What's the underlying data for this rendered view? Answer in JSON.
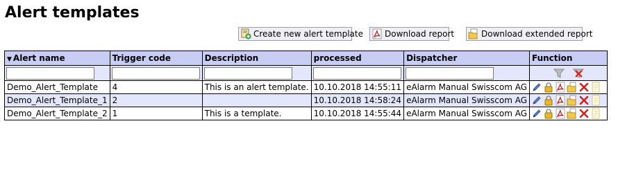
{
  "page": {
    "title": "Alert templates"
  },
  "toolbar": {
    "create_label": "Create new alert template",
    "download_label": "Download report",
    "download_ext_label": "Download extended report"
  },
  "table": {
    "sort_indicator": "▼",
    "headers": [
      "Alert name",
      "Trigger code",
      "Description",
      "processed",
      "Dispatcher",
      "Function"
    ],
    "filters": {
      "alert_name": "",
      "trigger_code": "",
      "description": "",
      "processed": "",
      "dispatcher": ""
    },
    "rows": [
      {
        "name": "Demo_Alert_Template",
        "trigger": "4",
        "description": "This is an alert template.",
        "processed": "10.10.2018 14:55:11",
        "dispatcher": "eAlarm Manual Swisscom AG"
      },
      {
        "name": "Demo_Alert_Template_1",
        "trigger": "2",
        "description": "",
        "processed": "10.10.2018 14:58:24",
        "dispatcher": "eAlarm Manual Swisscom AG"
      },
      {
        "name": "Demo_Alert_Template_2",
        "trigger": "1",
        "description": "This is a template.",
        "processed": "10.10.2018 14:55:44",
        "dispatcher": "eAlarm Manual Swisscom AG"
      }
    ],
    "row_actions": [
      "edit-icon",
      "lock-icon",
      "pdf-icon",
      "folder-icon",
      "delete-icon",
      "copy-icon"
    ],
    "filter_actions": [
      "filter-icon",
      "clear-filter-icon"
    ]
  },
  "colors": {
    "header_bg": "#c8cdf4",
    "alt_row_bg": "#e4e7fb",
    "delete": "#d42020",
    "pdf": "#c82020"
  }
}
